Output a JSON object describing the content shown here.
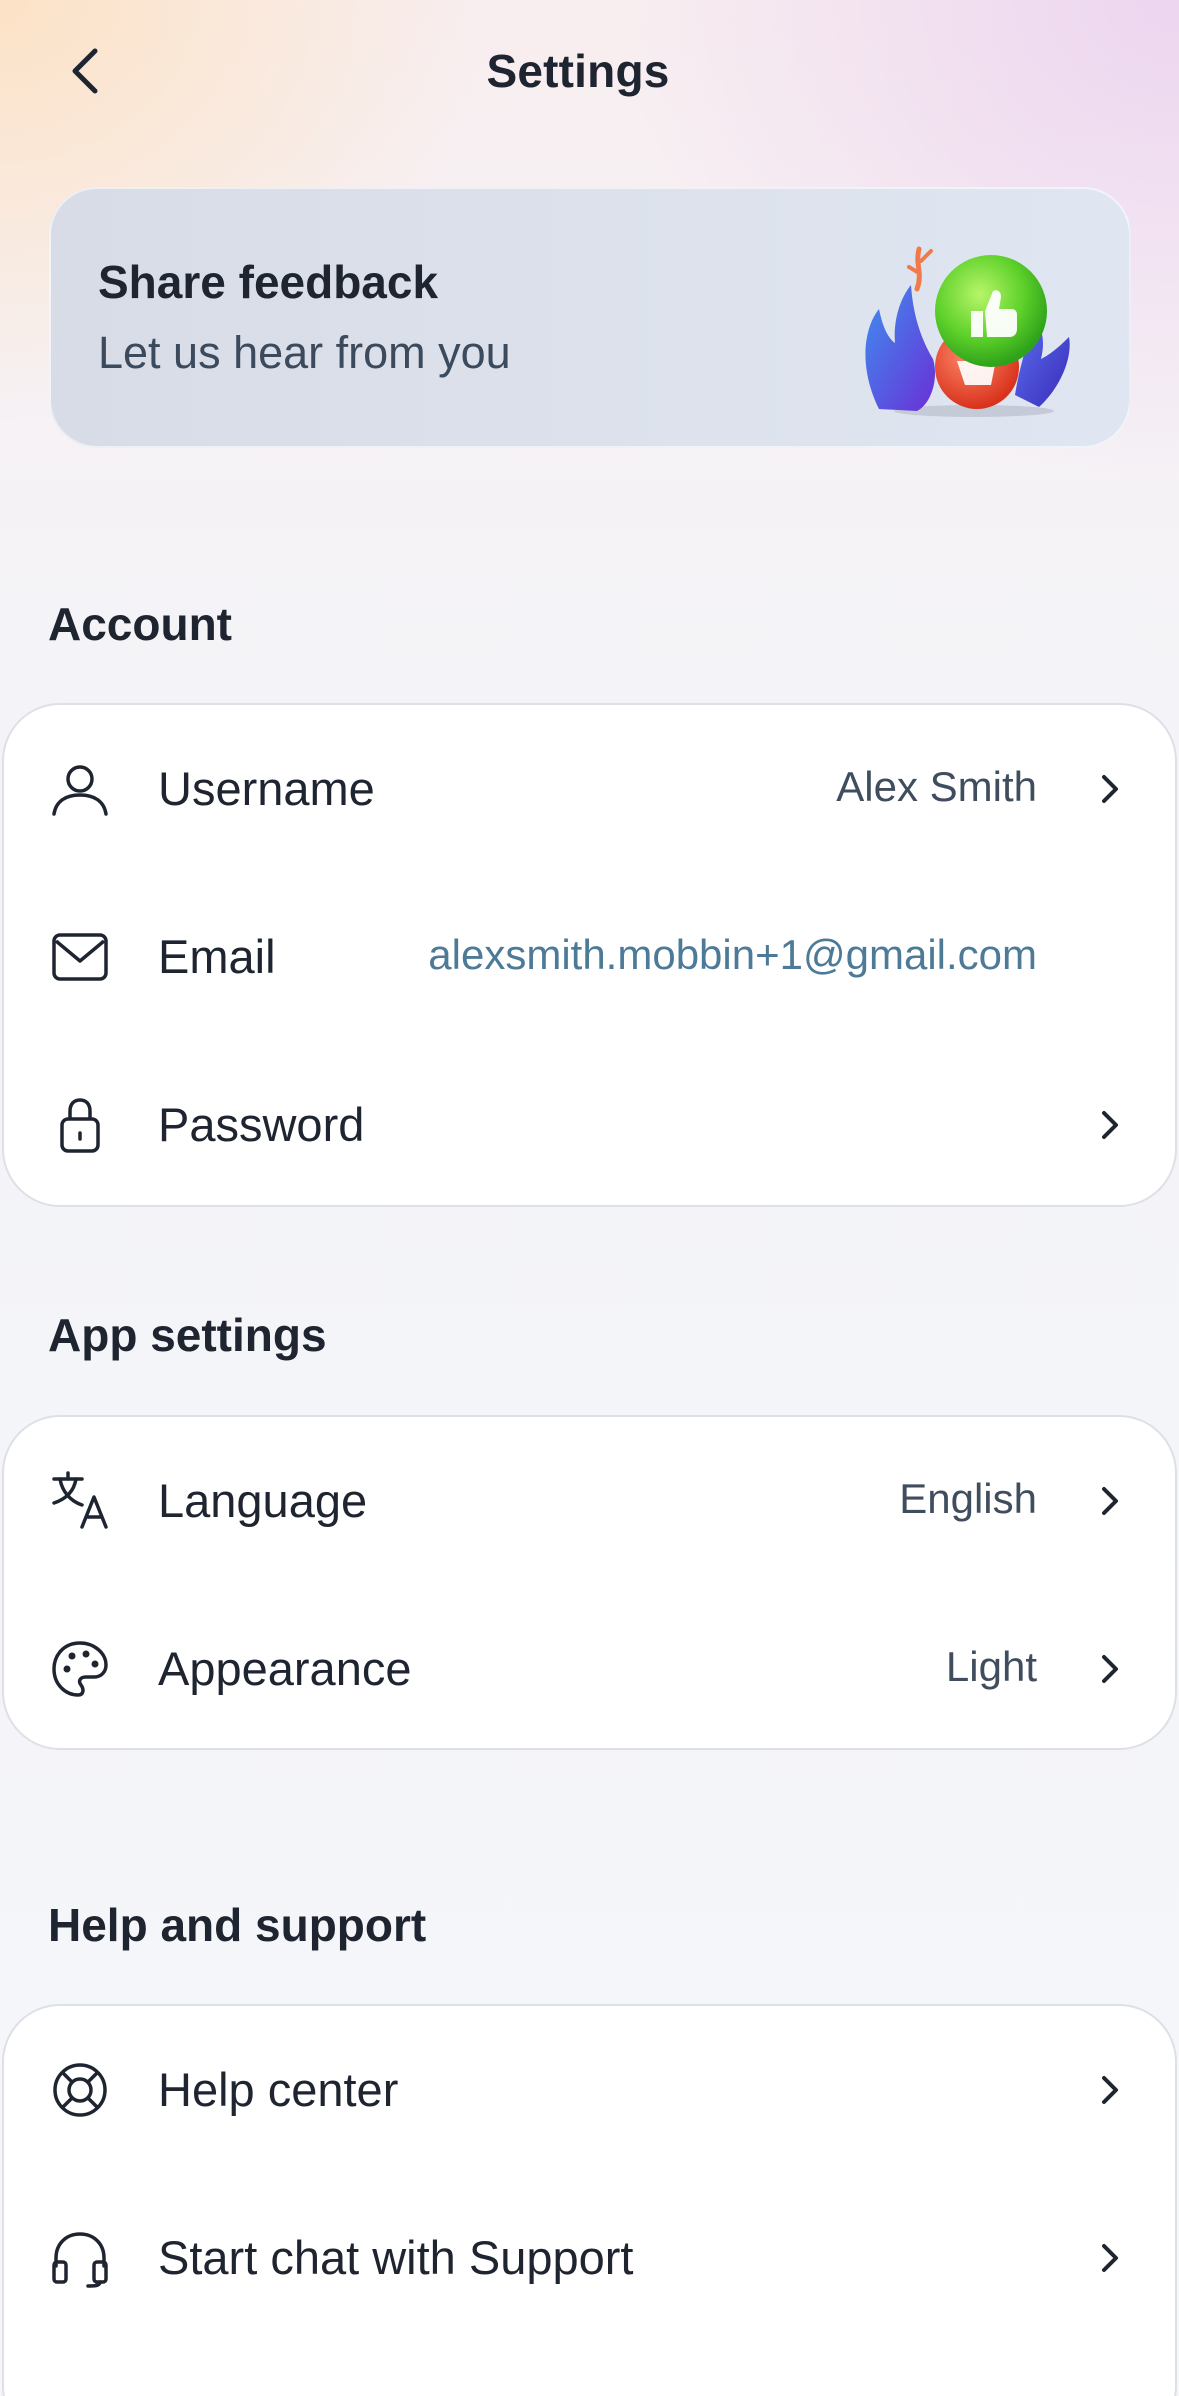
{
  "header": {
    "title": "Settings",
    "back_icon": "chevron-left-icon"
  },
  "feedback": {
    "title": "Share feedback",
    "subtitle": "Let us hear from you",
    "illustration": "thumbs-up-down-illustration"
  },
  "account": {
    "title": "Account",
    "items": [
      {
        "label": "Username",
        "value": "Alex Smith",
        "icon": "user-icon",
        "chevron": true
      },
      {
        "label": "Email",
        "value": "alexsmith.mobbin+1@gmail.com",
        "icon": "mail-icon",
        "chevron": false
      },
      {
        "label": "Password",
        "value": "",
        "icon": "lock-icon",
        "chevron": true
      }
    ]
  },
  "app_settings": {
    "title": "App settings",
    "items": [
      {
        "label": "Language",
        "value": "English",
        "icon": "translate-icon",
        "chevron": true
      },
      {
        "label": "Appearance",
        "value": "Light",
        "icon": "palette-icon",
        "chevron": true
      }
    ]
  },
  "help": {
    "title": "Help and support",
    "items": [
      {
        "label": "Help center",
        "icon": "lifebuoy-icon",
        "chevron": true
      },
      {
        "label": "Start chat with Support",
        "icon": "headphones-icon",
        "chevron": true
      }
    ]
  },
  "colors": {
    "text_primary": "#1f2530",
    "text_secondary": "#3f4d5e",
    "link": "#4d7a97",
    "card_bg": "#ffffff",
    "card_border": "#dde0e6"
  }
}
